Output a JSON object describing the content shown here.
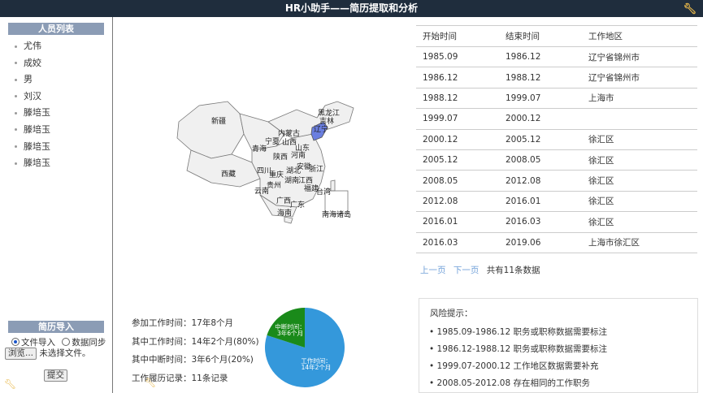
{
  "app": {
    "title": "HR小助手——简历提取和分析"
  },
  "sidebar": {
    "people_title": "人员列表",
    "people": [
      "尤伟",
      "成姣",
      "男",
      "刘汉",
      "滕培玉",
      "滕培玉",
      "滕培玉",
      "滕培玉"
    ],
    "import_title": "简历导入",
    "radio_file": "文件导入",
    "radio_sync": "数据同步",
    "browse_label": "浏览...",
    "no_file": "未选择文件。",
    "submit_label": "提交"
  },
  "map": {
    "highlight_color": "#6b7fe0",
    "labels": [
      "新疆",
      "西藏",
      "青海",
      "四川",
      "云南",
      "内蒙古",
      "黑龙江",
      "吉林",
      "辽宁",
      "宁夏",
      "山西",
      "陕西",
      "河南",
      "山东",
      "湖北",
      "安徽",
      "重庆",
      "贵州",
      "湖南",
      "江西",
      "浙江",
      "福建",
      "广西",
      "广东",
      "海南",
      "台湾",
      "南海诸岛"
    ]
  },
  "stats": {
    "lines": [
      "参加工作时间：17年8个月",
      "其中工作时间：14年2个月(80%)",
      "其中中断时间：3年6个月(20%)",
      "工作履历记录：11条记录"
    ]
  },
  "pie": {
    "work_label": "工作时间：",
    "work_value": "14年2个月",
    "break_label": "中断时间：",
    "break_value": "3年6个月",
    "work_fraction": 0.8,
    "break_fraction": 0.2,
    "work_color": "#3498db",
    "break_color": "#1a8a1a"
  },
  "jobs": {
    "headers": [
      "开始时间",
      "结束时间",
      "工作地区"
    ],
    "rows": [
      [
        "1985.09",
        "1986.12",
        "辽宁省锦州市"
      ],
      [
        "1986.12",
        "1988.12",
        "辽宁省锦州市"
      ],
      [
        "1988.12",
        "1999.07",
        "上海市"
      ],
      [
        "1999.07",
        "2000.12",
        ""
      ],
      [
        "2000.12",
        "2005.12",
        "徐汇区"
      ],
      [
        "2005.12",
        "2008.05",
        "徐汇区"
      ],
      [
        "2008.05",
        "2012.08",
        "徐汇区"
      ],
      [
        "2012.08",
        "2016.01",
        "徐汇区"
      ],
      [
        "2016.01",
        "2016.03",
        "徐汇区"
      ],
      [
        "2016.03",
        "2019.06",
        "上海市徐汇区"
      ]
    ]
  },
  "pager": {
    "prev": "上一页",
    "next": "下一页",
    "total": "共有11条数据"
  },
  "risk": {
    "title": "风险提示：",
    "items": [
      "1985.09-1986.12  职务或职称数据需要标注",
      "1986.12-1988.12  职务或职称数据需要标注",
      "1999.07-2000.12  工作地区数据需要补充",
      "2008.05-2012.08  存在相同的工作职务"
    ]
  },
  "icons": {
    "wrench": "wrench-icon",
    "accent": "#e8b84a"
  }
}
